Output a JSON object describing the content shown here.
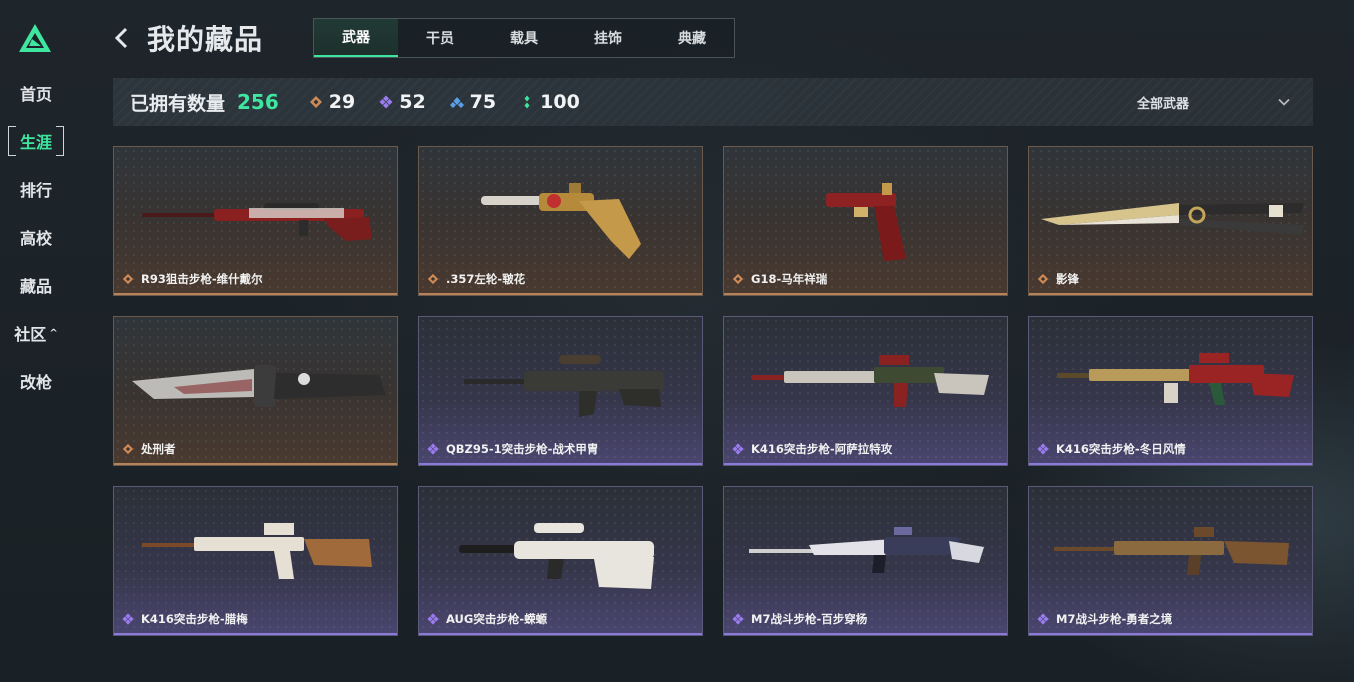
{
  "sidebar": {
    "items": [
      {
        "label": "首页",
        "active": false
      },
      {
        "label": "生涯",
        "active": true
      },
      {
        "label": "排行",
        "active": false
      },
      {
        "label": "高校",
        "active": false
      },
      {
        "label": "藏品",
        "active": false
      },
      {
        "label": "社区",
        "active": false,
        "expand_icon": "chevron-up-icon",
        "expand_glyph": "^"
      },
      {
        "label": "改枪",
        "active": false
      }
    ]
  },
  "header": {
    "back_icon": "chevron-left-icon",
    "title": "我的藏品",
    "tabs": [
      {
        "label": "武器",
        "active": true
      },
      {
        "label": "干员",
        "active": false
      },
      {
        "label": "载具",
        "active": false
      },
      {
        "label": "挂饰",
        "active": false
      },
      {
        "label": "典藏",
        "active": false
      }
    ]
  },
  "stats": {
    "owned_label": "已拥有数量",
    "owned_value": "256",
    "rarities": [
      {
        "icon": "orange-diamond-icon",
        "color": "#d08a55",
        "value": "29"
      },
      {
        "icon": "purple-diamond-icon",
        "color": "#9b7cf0",
        "value": "52"
      },
      {
        "icon": "blue-diamond-icon",
        "color": "#5aa0e6",
        "value": "75"
      },
      {
        "icon": "green-diamond-icon",
        "color": "#3fe6a0",
        "value": "100"
      }
    ],
    "filter_label": "全部武器",
    "filter_icon": "chevron-down-icon"
  },
  "colors": {
    "accent": "#3fe6a0",
    "orange": "#d08a55",
    "purple": "#9b7cf0"
  },
  "items": [
    {
      "name": "R93狙击步枪-维什戴尔",
      "rarity": "orange",
      "icon": "sniper-rifle-icon"
    },
    {
      "name": ".357左轮-皲花",
      "rarity": "orange",
      "icon": "revolver-icon"
    },
    {
      "name": "G18-马年祥瑞",
      "rarity": "orange",
      "icon": "pistol-icon"
    },
    {
      "name": "影锋",
      "rarity": "orange",
      "icon": "blade-icon"
    },
    {
      "name": "处刑者",
      "rarity": "orange",
      "icon": "knife-icon"
    },
    {
      "name": "QBZ95-1突击步枪-战术甲胄",
      "rarity": "purple",
      "icon": "bullpup-rifle-icon"
    },
    {
      "name": "K416突击步枪-阿萨拉特攻",
      "rarity": "purple",
      "icon": "assault-rifle-icon"
    },
    {
      "name": "K416突击步枪-冬日风情",
      "rarity": "purple",
      "icon": "assault-rifle-icon"
    },
    {
      "name": "K416突击步枪-腊梅",
      "rarity": "purple",
      "icon": "assault-rifle-icon"
    },
    {
      "name": "AUG突击步枪-蝾螈",
      "rarity": "purple",
      "icon": "bullpup-rifle-icon"
    },
    {
      "name": "M7战斗步枪-百步穿杨",
      "rarity": "purple",
      "icon": "battle-rifle-icon"
    },
    {
      "name": "M7战斗步枪-勇者之境",
      "rarity": "purple",
      "icon": "battle-rifle-icon"
    }
  ]
}
